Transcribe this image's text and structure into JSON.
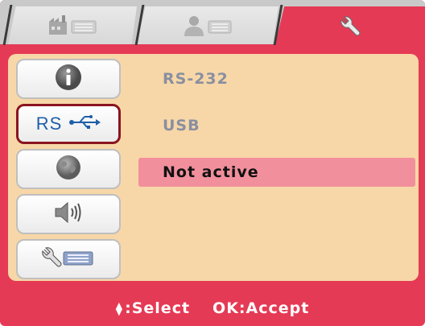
{
  "tabs": [
    {
      "name": "machine-tab",
      "active": false
    },
    {
      "name": "user-tab",
      "active": false
    },
    {
      "name": "settings-tab",
      "active": true
    }
  ],
  "sidebar": {
    "items": [
      {
        "name": "info",
        "label": "",
        "active": false
      },
      {
        "name": "rs-usb",
        "label": "RS",
        "active": true
      },
      {
        "name": "network",
        "label": "",
        "active": false
      },
      {
        "name": "sound",
        "label": "",
        "active": false
      },
      {
        "name": "tools",
        "label": "",
        "active": false
      }
    ]
  },
  "options": [
    {
      "label": "RS-232",
      "selected": false
    },
    {
      "label": "USB",
      "selected": false
    },
    {
      "label": "Not active",
      "selected": true
    }
  ],
  "footer": {
    "select_hint": ":Select",
    "accept_hint": "OK:Accept"
  },
  "colors": {
    "frame": "#e53a55",
    "panel": "#f7d7a8",
    "selection": "#f28f9c",
    "dim_text": "#8a8fa0"
  }
}
